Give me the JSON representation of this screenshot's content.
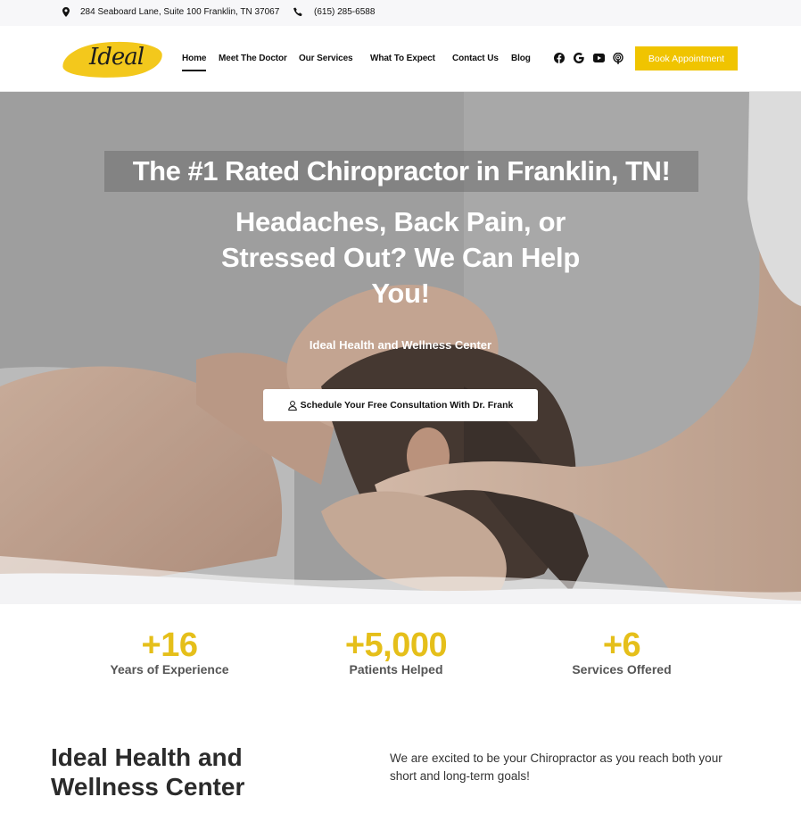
{
  "topbar": {
    "address": "284 Seaboard Lane, Suite 100 Franklin, TN 37067",
    "phone": "(615) 285-6588"
  },
  "header": {
    "logo_text": "Ideal",
    "nav": [
      {
        "label": "Home",
        "active": true
      },
      {
        "label": "Meet The Doctor"
      },
      {
        "label": "Our Services"
      },
      {
        "label": "What To Expect"
      },
      {
        "label": "Contact Us"
      },
      {
        "label": "Blog"
      }
    ],
    "social_icons": [
      "facebook-icon",
      "google-icon",
      "youtube-icon",
      "podcast-icon"
    ],
    "book_label": "Book Appointment"
  },
  "hero": {
    "title": "The #1 Rated Chiropractor in Franklin, TN!",
    "subtitle": "Headaches, Back Pain, or Stressed Out? We Can Help You!",
    "center_name": "Ideal Health and Wellness Center",
    "cta_label": "Schedule Your Free Consultation With Dr. Frank"
  },
  "stats": [
    {
      "value": "+16",
      "label": "Years of Experience"
    },
    {
      "value": "+5,000",
      "label": "Patients Helped"
    },
    {
      "value": "+6",
      "label": "Services Offered"
    }
  ],
  "about": {
    "title": "Ideal Health and Wellness Center",
    "text": "We are excited to be your Chiropractor as you reach both your short and long-term goals!"
  },
  "colors": {
    "accent": "#f0c400",
    "stat_number": "#e5bf1a",
    "topbar_bg": "#f7f7f9"
  }
}
